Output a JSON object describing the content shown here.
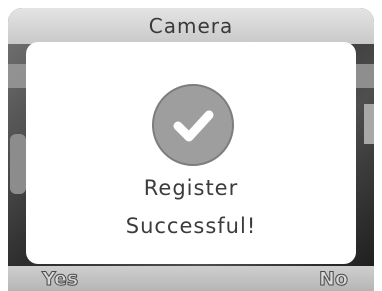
{
  "screen": {
    "title": "Camera"
  },
  "dialog": {
    "icon": "checkmark-icon",
    "message_line1": "Register",
    "message_line2": "Successful!"
  },
  "softkeys": {
    "left_label": "Yes",
    "right_label": "No"
  },
  "colors": {
    "title_bar": "#d6d6d6",
    "dialog_bg": "#ffffff",
    "badge": "#9e9e9e",
    "text": "#3c3c3c"
  }
}
